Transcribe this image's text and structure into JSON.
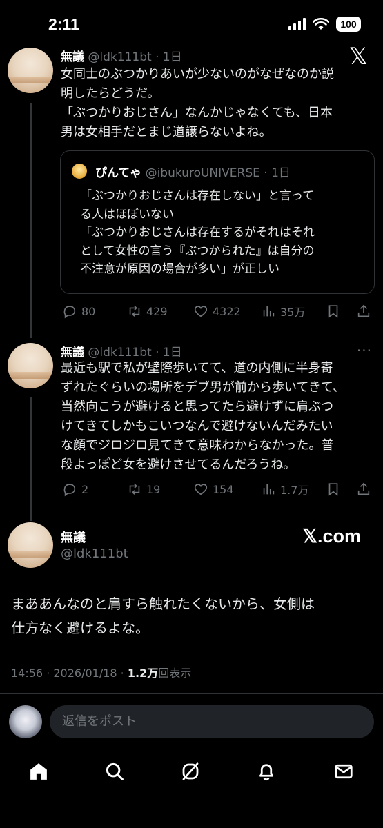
{
  "status_bar": {
    "time": "2:11",
    "battery": "100"
  },
  "tweets": [
    {
      "name": "無議",
      "handle": "@ldk111bt",
      "time": "· 1日",
      "text": "女同士のぶつかりあいが少ないのがなぜなのか説\n明したらどうだ。\n「ぶつかりおじさん」なんかじゃなくても、日本\n男は女相手だとまじ道譲らないよね。",
      "quote": {
        "name": "ぴんてゃ",
        "handle": "@ibukuroUNIVERSE",
        "time": "· 1日",
        "text": "「ぶつかりおじさんは存在しない」と言って\nる人はほぼいない\n「ぶつかりおじさんは存在するがそれはそれ\nとして女性の言う『ぶつかられた』は自分の\n不注意が原因の場合が多い」が正しい"
      },
      "replies": "80",
      "reposts": "429",
      "likes": "4322",
      "views": "35万"
    },
    {
      "name": "無議",
      "handle": "@ldk111bt",
      "time": "· 1日",
      "text": "最近も駅で私が壁際歩いてて、道の内側に半身寄\nずれたぐらいの場所をデブ男が前から歩いてきて、\n当然向こうが避けると思ってたら避けずに肩ぶつ\nけてきてしかもこいつなんで避けないんだみたい\nな顔でジロジロ見てきて意味わからなかった。普\n段よっぽど女を避けさせてるんだろうね。",
      "replies": "2",
      "reposts": "19",
      "likes": "154",
      "views": "1.7万"
    }
  ],
  "main_tweet": {
    "name": "無議",
    "handle": "@ldk111bt",
    "brand": "𝕏.com",
    "text": "まああんなのと肩すら触れたくないから、女側は\n仕方なく避けるよな。",
    "timestamp": "14:56 · 2026/01/18 · ",
    "view_count": "1.2万",
    "view_label": "回表示"
  },
  "reply_bar": {
    "placeholder": "返信をポスト"
  },
  "icons": {
    "close": "x-logo-icon",
    "tabs": [
      "home-icon",
      "search-icon",
      "grok-icon",
      "notifications-icon",
      "messages-icon"
    ]
  },
  "colors": {
    "background": "#000000",
    "text": "#e7e9ea",
    "muted": "#71767b",
    "border": "#2f3336"
  }
}
